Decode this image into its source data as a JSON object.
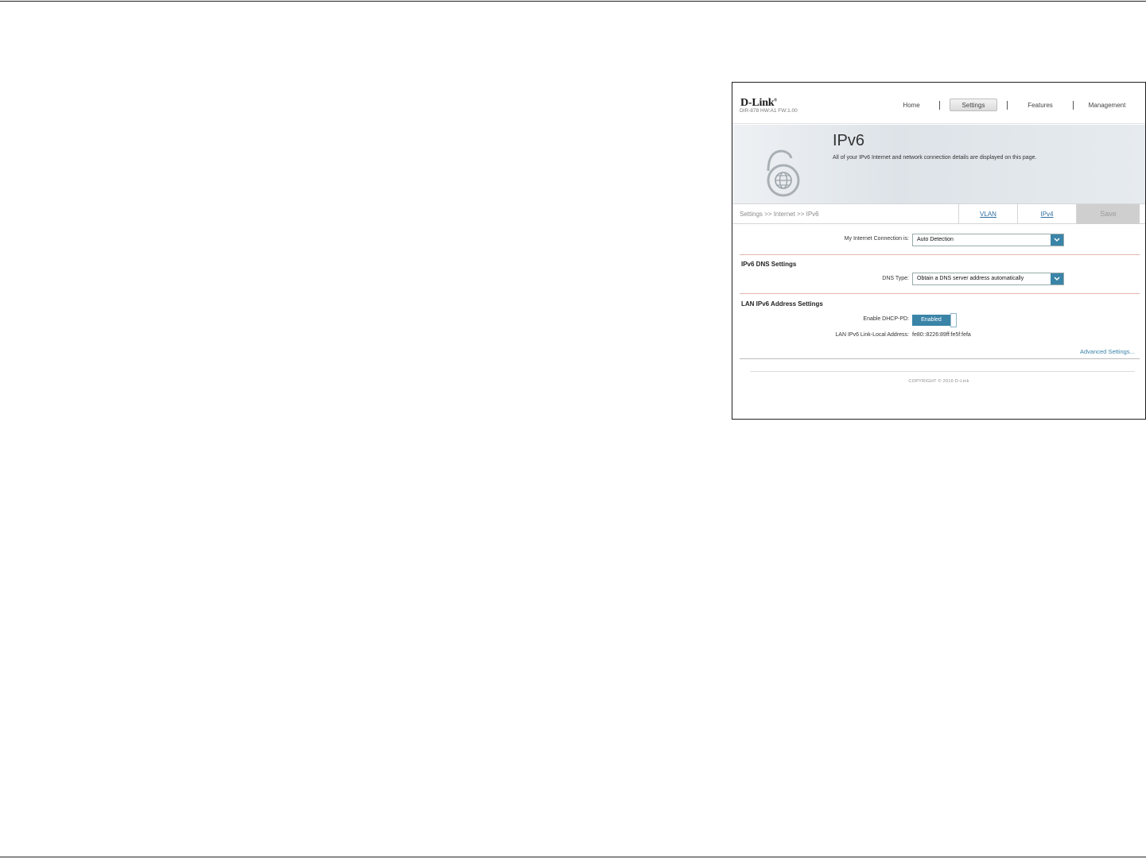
{
  "router": {
    "brand": "D-Link",
    "model_info": "DIR-878 HW:A1 FW:1.00",
    "nav": {
      "home": "Home",
      "settings": "Settings",
      "features": "Features",
      "management": "Management"
    },
    "page": {
      "title": "IPv6",
      "description": "All of your IPv6 Internet and network connection details are displayed on this page."
    },
    "breadcrumb": "Settings >> Internet >> IPv6",
    "tabs": {
      "vlan": "VLAN",
      "ipv4": "IPv4",
      "save": "Save"
    },
    "connection": {
      "label": "My Internet Connection is:",
      "value": "Auto Detection"
    },
    "dns": {
      "section_title": "IPv6 DNS Settings",
      "label": "DNS Type:",
      "value": "Obtain a DNS server address automatically"
    },
    "lan": {
      "section_title": "LAN IPv6 Address Settings",
      "dhcp_label": "Enable DHCP-PD:",
      "dhcp_value": "Enabled",
      "link_local_label": "LAN IPv6 Link-Local Address:",
      "link_local_value": "fe80::8226:89ff:fe5f:fefa"
    },
    "advanced_link": "Advanced Settings...",
    "copyright": "COPYRIGHT © 2016 D-Link"
  },
  "colors": {
    "accent": "#3a84a8",
    "save_disabled": "#cfcfcf",
    "section_divider": "#e6b6ae"
  }
}
